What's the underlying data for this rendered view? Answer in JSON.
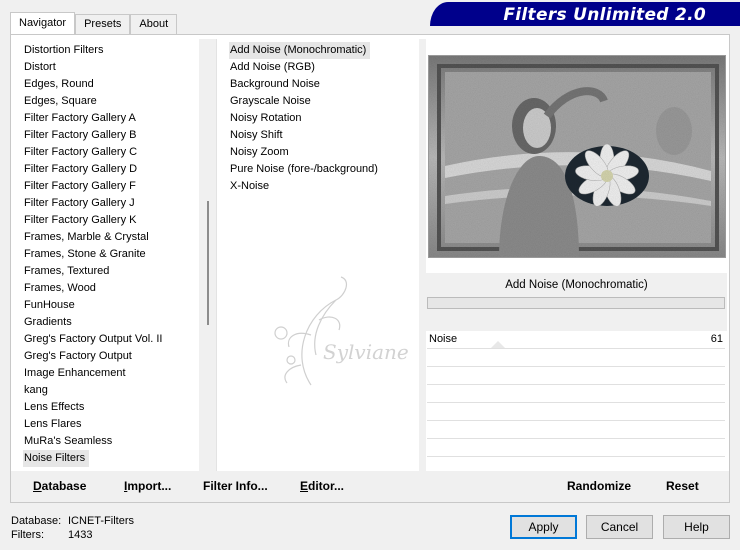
{
  "tabs": [
    {
      "label": "Navigator",
      "active": true
    },
    {
      "label": "Presets",
      "active": false
    },
    {
      "label": "About",
      "active": false
    }
  ],
  "banner": {
    "title": "Filters Unlimited 2.0"
  },
  "categories": [
    "Distortion Filters",
    "Distort",
    "Edges, Round",
    "Edges, Square",
    "Filter Factory Gallery A",
    "Filter Factory Gallery B",
    "Filter Factory Gallery C",
    "Filter Factory Gallery D",
    "Filter Factory Gallery F",
    "Filter Factory Gallery J",
    "Filter Factory Gallery K",
    "Frames, Marble & Crystal",
    "Frames, Stone & Granite",
    "Frames, Textured",
    "Frames, Wood",
    "FunHouse",
    "Gradients",
    "Greg's Factory Output Vol. II",
    "Greg's Factory Output",
    "Image Enhancement",
    "kang",
    "Lens Effects",
    "Lens Flares",
    "MuRa's Seamless",
    "Noise Filters"
  ],
  "selected_category_index": 24,
  "filters": [
    "Add Noise (Monochromatic)",
    "Add Noise (RGB)",
    "Background Noise",
    "Grayscale Noise",
    "Noisy Rotation",
    "Noisy Shift",
    "Noisy Zoom",
    "Pure Noise (fore-/background)",
    "X-Noise"
  ],
  "selected_filter_index": 0,
  "preview": {
    "filter_name": "Add Noise (Monochromatic)",
    "watermark_text": "Sylviane"
  },
  "params": [
    {
      "label": "Noise",
      "value": "61"
    }
  ],
  "bottom_buttons": {
    "database": "Database",
    "import": "Import...",
    "filter_info": "Filter Info...",
    "editor": "Editor...",
    "randomize": "Randomize",
    "reset": "Reset"
  },
  "status": {
    "database_label": "Database:",
    "database_value": "ICNET-Filters",
    "filters_label": "Filters:",
    "filters_value": "1433"
  },
  "dialog_buttons": {
    "apply": "Apply",
    "cancel": "Cancel",
    "help": "Help"
  },
  "colors": {
    "banner": "#00008b",
    "default_button_border": "#0078d7"
  }
}
